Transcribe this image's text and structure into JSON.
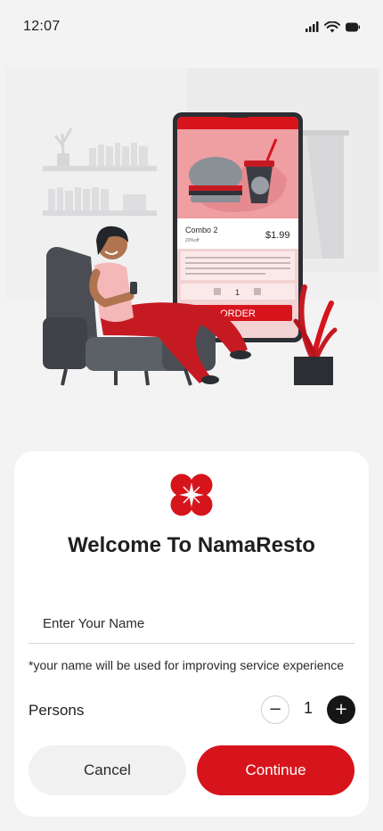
{
  "status_bar": {
    "time": "12:07",
    "icons": [
      "signal-icon",
      "wifi-icon",
      "battery-icon"
    ]
  },
  "illustration": {
    "product_name": "Combo 2",
    "discount": "20%off",
    "price": "$1.99",
    "quantity": "1",
    "order_label": "ORDER"
  },
  "welcome": {
    "title": "Welcome To NamaResto",
    "name_placeholder": "Enter Your Name",
    "hint": "*your name will be used for improving service experience"
  },
  "persons": {
    "label": "Persons",
    "value": "1",
    "minus_symbol": "−",
    "plus_symbol": "+"
  },
  "actions": {
    "cancel_label": "Cancel",
    "continue_label": "Continue"
  },
  "colors": {
    "accent": "#d7141c",
    "background": "#f3f3f4",
    "sheet": "#ffffff",
    "dark": "#161616"
  }
}
